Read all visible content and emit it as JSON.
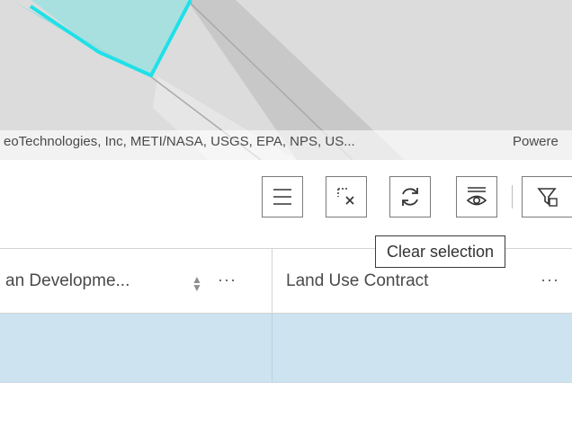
{
  "map": {
    "attribution": "eoTechnologies, Inc, METI/NASA, USGS, EPA, NPS, US...",
    "powered_by": "Powere"
  },
  "toolbar": {
    "buttons": [
      {
        "name": "menu-button",
        "icon": "hamburger-menu-icon"
      },
      {
        "name": "clear-selection-button",
        "icon": "clear-selection-icon"
      },
      {
        "name": "refresh-button",
        "icon": "refresh-icon"
      },
      {
        "name": "show-selected-button",
        "icon": "show-selection-icon"
      },
      {
        "name": "filter-by-map-button",
        "icon": "filter-by-map-icon"
      }
    ],
    "tooltip": "Clear selection"
  },
  "table": {
    "columns": [
      {
        "label": "an Developme...",
        "sort_icon": "sort-icon",
        "more": "···"
      },
      {
        "label": "Land Use Contract",
        "sort_icon": "sort-icon",
        "more": "···"
      }
    ],
    "rows": [
      {
        "cells": [
          "",
          ""
        ],
        "selected": true
      }
    ]
  },
  "colors": {
    "selected_row": "#cde3f0",
    "parcel_fill": "#a8e0e0",
    "parcel_outline": "#1fe0e8",
    "map_background": "#dcdcdc"
  }
}
